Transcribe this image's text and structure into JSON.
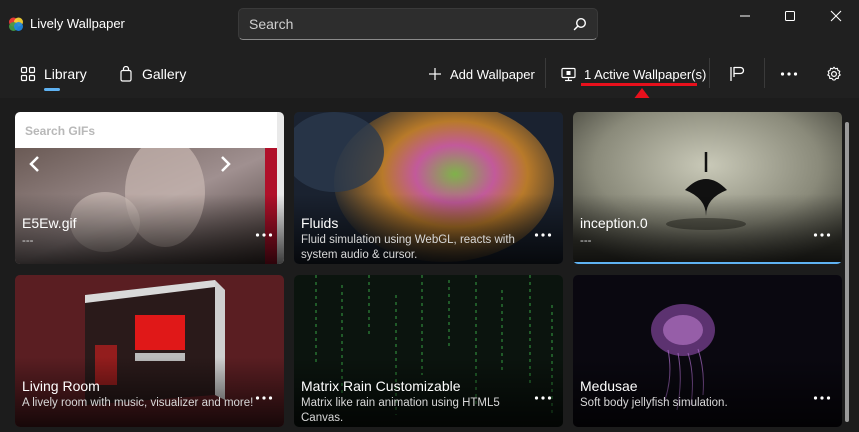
{
  "app": {
    "title": "Lively Wallpaper",
    "logo": "lively-logo-icon"
  },
  "search": {
    "placeholder": "Search",
    "icon": "search-icon"
  },
  "window_controls": [
    "minimize-icon",
    "maximize-icon",
    "close-icon"
  ],
  "nav": {
    "library_label": "Library",
    "gallery_label": "Gallery",
    "active": "Library"
  },
  "toolbar": {
    "add_label": "Add Wallpaper",
    "active_label": "1 Active Wallpaper(s)",
    "icons": [
      "plus-icon",
      "monitor-icon",
      "pause-flag-icon",
      "more-icon",
      "settings-icon"
    ]
  },
  "annotation": {
    "color": "#e8101c"
  },
  "accent": "#5fb2f2",
  "gif_card": {
    "search_placeholder": "Search GIFs"
  },
  "wallpapers": [
    {
      "title": "E5Ew.gif",
      "desc": "---",
      "active": false
    },
    {
      "title": "Fluids",
      "desc": "Fluid simulation using WebGL, reacts with system audio & cursor.",
      "active": false
    },
    {
      "title": "inception.0",
      "desc": "---",
      "active": true
    },
    {
      "title": "Living Room",
      "desc": "A lively room with music, visualizer and more!",
      "active": false
    },
    {
      "title": "Matrix Rain Customizable",
      "desc": "Matrix like rain animation using HTML5 Canvas.",
      "active": false
    },
    {
      "title": "Medusae",
      "desc": "Soft body jellyfish simulation.",
      "active": false
    }
  ]
}
